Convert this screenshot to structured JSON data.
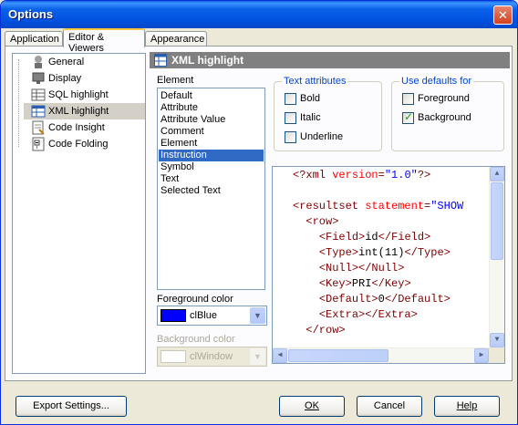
{
  "window": {
    "title": "Options",
    "close_glyph": "✕"
  },
  "tabs": [
    {
      "label": "Application",
      "active": false
    },
    {
      "label": "Editor & Viewers",
      "active": true
    },
    {
      "label": "Appearance",
      "active": false
    }
  ],
  "tree": {
    "items": [
      {
        "label": "General",
        "icon": "general-icon"
      },
      {
        "label": "Display",
        "icon": "display-icon"
      },
      {
        "label": "SQL highlight",
        "icon": "sql-highlight-icon"
      },
      {
        "label": "XML highlight",
        "icon": "xml-highlight-icon",
        "selected": true
      },
      {
        "label": "Code Insight",
        "icon": "code-insight-icon"
      },
      {
        "label": "Code Folding",
        "icon": "code-folding-icon"
      }
    ]
  },
  "section": {
    "title": "XML highlight",
    "icon": "xml-highlight-icon"
  },
  "element_panel": {
    "label": "Element",
    "items": [
      "Default",
      "Attribute",
      "Attribute Value",
      "Comment",
      "Element",
      "Instruction",
      "Symbol",
      "Text",
      "Selected Text"
    ],
    "selected_index": 5
  },
  "foreground_color": {
    "label": "Foreground color",
    "value": "clBlue",
    "swatch": "#0000ff"
  },
  "background_color": {
    "label": "Background color",
    "value": "clWindow",
    "swatch": "#ffffff",
    "disabled": true
  },
  "text_attributes": {
    "title": "Text attributes",
    "bold": {
      "label": "Bold",
      "checked": false
    },
    "italic": {
      "label": "Italic",
      "checked": false
    },
    "underline": {
      "label": "Underline",
      "checked": false
    }
  },
  "use_defaults": {
    "title": "Use defaults for",
    "foreground": {
      "label": "Foreground",
      "checked": false
    },
    "background": {
      "label": "Background",
      "checked": true
    }
  },
  "preview": {
    "lines": [
      {
        "indent": "",
        "parts": [
          [
            "tag",
            "<?xml "
          ],
          [
            "attr",
            "version"
          ],
          [
            "tag",
            "="
          ],
          [
            "val",
            "\"1.0\""
          ],
          [
            "tag",
            "?>"
          ]
        ]
      },
      {
        "indent": "",
        "parts": []
      },
      {
        "indent": "",
        "parts": [
          [
            "tag",
            "<resultset "
          ],
          [
            "attr",
            "statement"
          ],
          [
            "tag",
            "="
          ],
          [
            "val",
            "\"SHOW"
          ]
        ]
      },
      {
        "indent": "  ",
        "parts": [
          [
            "tag",
            "<row>"
          ]
        ]
      },
      {
        "indent": "    ",
        "parts": [
          [
            "tag",
            "<Field>"
          ],
          [
            "txt",
            "id"
          ],
          [
            "tag",
            "</Field>"
          ]
        ]
      },
      {
        "indent": "    ",
        "parts": [
          [
            "tag",
            "<Type>"
          ],
          [
            "txt",
            "int(11)"
          ],
          [
            "tag",
            "</Type>"
          ]
        ]
      },
      {
        "indent": "    ",
        "parts": [
          [
            "tag",
            "<Null></Null>"
          ]
        ]
      },
      {
        "indent": "    ",
        "parts": [
          [
            "tag",
            "<Key>"
          ],
          [
            "txt",
            "PRI"
          ],
          [
            "tag",
            "</Key>"
          ]
        ]
      },
      {
        "indent": "    ",
        "parts": [
          [
            "tag",
            "<Default>"
          ],
          [
            "txt",
            "0"
          ],
          [
            "tag",
            "</Default>"
          ]
        ]
      },
      {
        "indent": "    ",
        "parts": [
          [
            "tag",
            "<Extra></Extra>"
          ]
        ]
      },
      {
        "indent": "  ",
        "parts": [
          [
            "tag",
            "</row>"
          ]
        ]
      }
    ]
  },
  "footer": {
    "export_label": "Export Settings...",
    "ok_label": "OK",
    "cancel_label": "Cancel",
    "help_label": "Help"
  }
}
